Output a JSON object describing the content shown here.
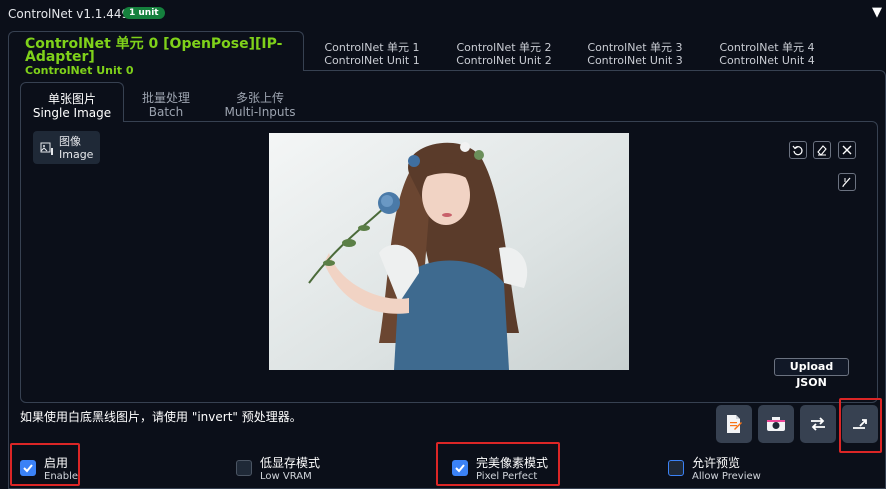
{
  "header": {
    "title": "ControlNet v1.1.449",
    "badge": "1 unit",
    "collapse_icon": "triangle-down-icon"
  },
  "unit_tabs": [
    {
      "zh": "ControlNet 单元 0 [OpenPose][IP-Adapter]",
      "en": "ControlNet Unit 0",
      "active": true
    },
    {
      "zh": "ControlNet 单元 1",
      "en": "ControlNet Unit 1"
    },
    {
      "zh": "ControlNet 单元 2",
      "en": "ControlNet Unit 2"
    },
    {
      "zh": "ControlNet 单元 3",
      "en": "ControlNet Unit 3"
    },
    {
      "zh": "ControlNet 单元 4",
      "en": "ControlNet Unit 4"
    }
  ],
  "input_tabs": [
    {
      "zh": "单张图片",
      "en": "Single Image",
      "active": true
    },
    {
      "zh": "批量处理",
      "en": "Batch"
    },
    {
      "zh": "多张上传",
      "en": "Multi-Inputs"
    }
  ],
  "image_panel": {
    "label_zh": "图像",
    "label_en": "Image",
    "upload_json": "Upload JSON",
    "tools": [
      "undo-icon",
      "eraser-icon",
      "close-icon",
      "brush-icon"
    ]
  },
  "hint": "如果使用白底黑线图片，请使用 \"invert\" 预处理器。",
  "action_buttons": [
    "document-icon",
    "camera-icon",
    "swap-icon",
    "send-dimensions-icon"
  ],
  "checkboxes": [
    {
      "zh": "启用",
      "en": "Enable",
      "checked": true
    },
    {
      "zh": "低显存模式",
      "en": "Low VRAM",
      "checked": false
    },
    {
      "zh": "完美像素模式",
      "en": "Pixel Perfect",
      "checked": true
    },
    {
      "zh": "允许预览",
      "en": "Allow Preview",
      "checked": false
    }
  ],
  "colors": {
    "background": "#0b0f19",
    "active_tab_text": "#7fd11a",
    "badge": "#15803d",
    "checkbox_on": "#3b82f6",
    "highlight_box": "#dc2626"
  }
}
